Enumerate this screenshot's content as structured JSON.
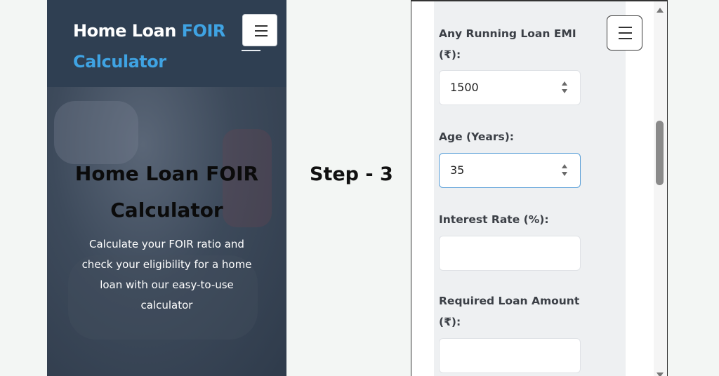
{
  "left_screen": {
    "site_title_part1": "Home Loan",
    "site_title_accent": "FOIR",
    "site_title_part2": "Calculator",
    "hero_title": "Home Loan FOIR Calculator",
    "hero_description": "Calculate your FOIR ratio and check your eligibility for a home loan with our easy-to-use calculator",
    "menu_icon": "hamburger-menu-icon"
  },
  "step_label": "Step - 3",
  "right_screen": {
    "menu_icon": "hamburger-menu-icon",
    "fields": [
      {
        "label_line1": "Any Running Loan EMI",
        "label_line2": "(₹):",
        "value": "1500",
        "type": "number",
        "focused": false
      },
      {
        "label_line1": "Age (Years):",
        "value": "35",
        "type": "number",
        "focused": true
      },
      {
        "label_line1": "Interest Rate (%):",
        "value": "",
        "type": "text",
        "focused": false
      },
      {
        "label_line1": "Required Loan Amount",
        "label_line2": "(₹):",
        "value": "",
        "type": "text",
        "focused": false
      }
    ]
  },
  "colors": {
    "accent": "#3fa3e3",
    "header_bg": "#2f3f52",
    "focus_border": "#5a9fd8",
    "form_bg": "#eef0f2"
  }
}
